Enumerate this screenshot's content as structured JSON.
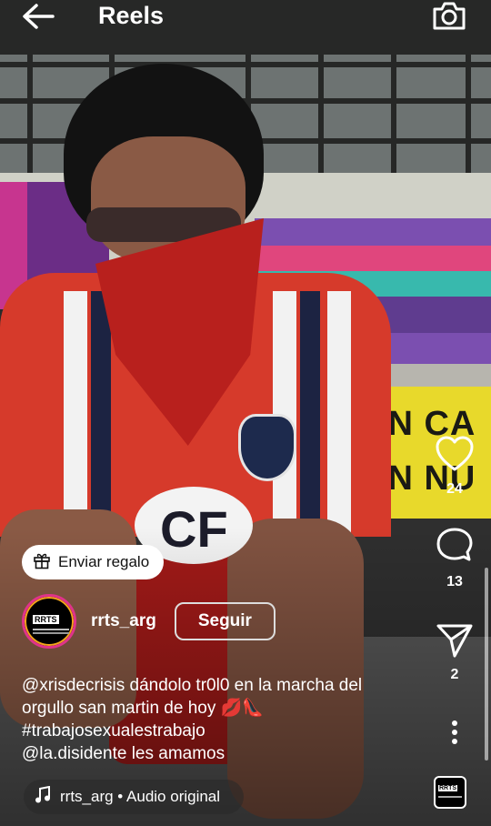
{
  "topbar": {
    "title": "Reels",
    "back_icon": "arrow-left-icon",
    "camera_icon": "camera-icon"
  },
  "gift": {
    "label": "Enviar regalo",
    "icon": "gift-icon"
  },
  "actions": {
    "likes": "24",
    "comments": "13",
    "shares": "2"
  },
  "author": {
    "username": "rrts_arg",
    "follow_label": "Seguir",
    "avatar_text": "RRTS"
  },
  "caption": {
    "mention1": "@xrisdecrisis",
    "line1_text": " dándolo tr0l0 en la marcha del",
    "line2_text": "orgullo san martin de hoy 💋👠",
    "hashtag": "#trabajosexualestrabajo",
    "mention2": "@la.disidente",
    "line4_text": " les amamos"
  },
  "audio": {
    "label": "rrts_arg • Audio original",
    "thumb_text": "RRTS"
  },
  "video_text": {
    "banner_line1": "UN CA",
    "banner_line2": "UN NU"
  },
  "colors": {
    "gift_bg": "#ffffff",
    "avatar_ring": "#e0338a",
    "text": "#ffffff"
  }
}
